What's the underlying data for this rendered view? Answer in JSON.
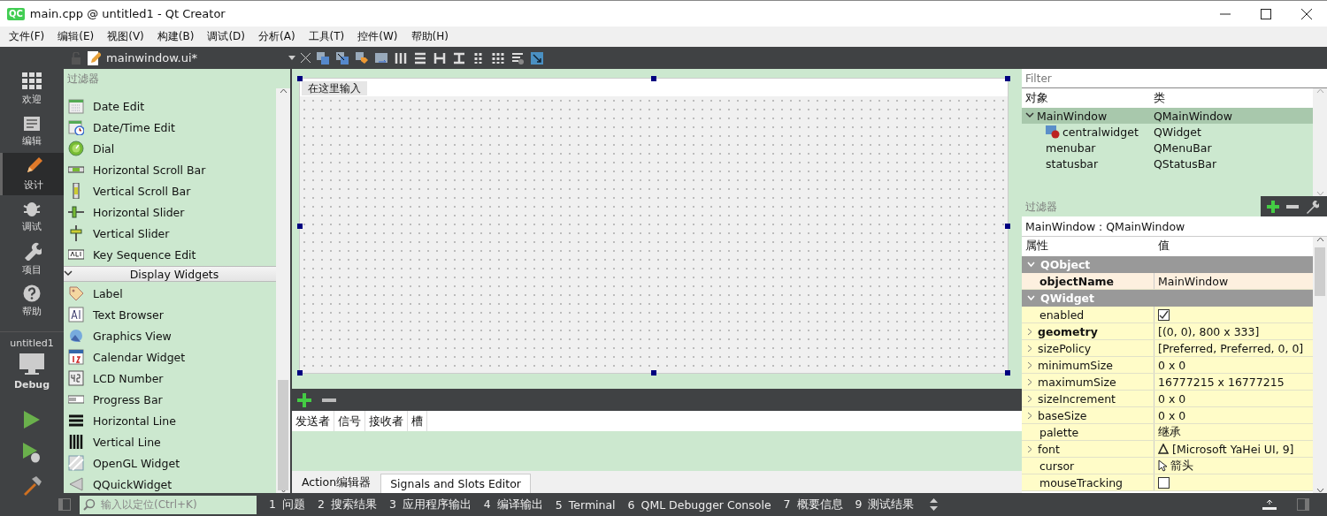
{
  "window": {
    "logo": "QC",
    "title": "main.cpp @ untitled1 - Qt Creator"
  },
  "menu": [
    "文件(F)",
    "编辑(E)",
    "视图(V)",
    "构建(B)",
    "调试(D)",
    "分析(A)",
    "工具(T)",
    "控件(W)",
    "帮助(H)"
  ],
  "modes": [
    {
      "kind": "welcome",
      "label": "欢迎",
      "selected": false
    },
    {
      "kind": "edit",
      "label": "编辑",
      "selected": false
    },
    {
      "kind": "design",
      "label": "设计",
      "selected": true
    },
    {
      "kind": "debug",
      "label": "调试",
      "selected": false
    },
    {
      "kind": "projects",
      "label": "项目",
      "selected": false
    },
    {
      "kind": "help",
      "label": "帮助",
      "selected": false
    }
  ],
  "project": {
    "name": "untitled1",
    "config": "Debug"
  },
  "editor": {
    "file": "mainwindow.ui*"
  },
  "widget_box": {
    "filter_placeholder": "过滤器",
    "items": [
      {
        "kind": "item",
        "label": "Date Edit"
      },
      {
        "kind": "item",
        "label": "Date/Time Edit"
      },
      {
        "kind": "item",
        "label": "Dial"
      },
      {
        "kind": "item",
        "label": "Horizontal Scroll Bar"
      },
      {
        "kind": "item",
        "label": "Vertical Scroll Bar"
      },
      {
        "kind": "item",
        "label": "Horizontal Slider"
      },
      {
        "kind": "item",
        "label": "Vertical Slider"
      },
      {
        "kind": "item",
        "label": "Key Sequence Edit"
      },
      {
        "kind": "category",
        "label": "Display Widgets",
        "expanded": true
      },
      {
        "kind": "item",
        "label": "Label"
      },
      {
        "kind": "item",
        "label": "Text Browser"
      },
      {
        "kind": "item",
        "label": "Graphics View"
      },
      {
        "kind": "item",
        "label": "Calendar Widget"
      },
      {
        "kind": "item",
        "label": "LCD Number"
      },
      {
        "kind": "item",
        "label": "Progress Bar"
      },
      {
        "kind": "item",
        "label": "Horizontal Line"
      },
      {
        "kind": "item",
        "label": "Vertical Line"
      },
      {
        "kind": "item",
        "label": "OpenGL Widget"
      },
      {
        "kind": "item",
        "label": "QQuickWidget"
      }
    ]
  },
  "form": {
    "menu_hint": "在这里输入"
  },
  "signals_editor": {
    "columns": [
      "发送者",
      "信号",
      "接收者",
      "槽"
    ],
    "tabs": [
      {
        "label": "Action编辑器",
        "selected": false
      },
      {
        "label": "Signals and Slots Editor",
        "selected": true
      }
    ]
  },
  "object_inspector": {
    "filter_placeholder": "Filter",
    "columns": [
      "对象",
      "类"
    ],
    "tree": [
      {
        "name": "MainWindow",
        "class": "QMainWindow",
        "selected": true,
        "expanded": true,
        "children": [
          {
            "name": "centralwidget",
            "class": "QWidget",
            "selected": false,
            "kind": "icon"
          },
          {
            "name": "menubar",
            "class": "QMenuBar",
            "selected": false,
            "kind": "plain"
          },
          {
            "name": "statusbar",
            "class": "QStatusBar",
            "selected": false,
            "kind": "plain"
          }
        ]
      }
    ]
  },
  "property_editor": {
    "filter_placeholder": "过滤器",
    "object": "MainWindow : QMainWindow",
    "columns": [
      "属性",
      "值"
    ],
    "groups": [
      {
        "name": "QObject",
        "expanded": true,
        "color": "#fdf0df",
        "properties": [
          {
            "name": "objectName",
            "kind": "text",
            "value": "MainWindow",
            "modified": true,
            "expandable": false
          }
        ]
      },
      {
        "name": "QWidget",
        "expanded": true,
        "color": "#fffcc8",
        "properties": [
          {
            "name": "enabled",
            "kind": "checkbox",
            "checked": true,
            "modified": false,
            "expandable": false
          },
          {
            "name": "geometry",
            "kind": "text",
            "value": "[(0, 0), 800 x 333]",
            "modified": true,
            "expandable": true
          },
          {
            "name": "sizePolicy",
            "kind": "text",
            "value": "[Preferred, Preferred, 0, 0]",
            "modified": false,
            "expandable": true
          },
          {
            "name": "minimumSize",
            "kind": "text",
            "value": "0 x 0",
            "modified": false,
            "expandable": true
          },
          {
            "name": "maximumSize",
            "kind": "text",
            "value": "16777215 x 16777215",
            "modified": false,
            "expandable": true
          },
          {
            "name": "sizeIncrement",
            "kind": "text",
            "value": "0 x 0",
            "modified": false,
            "expandable": true
          },
          {
            "name": "baseSize",
            "kind": "text",
            "value": "0 x 0",
            "modified": false,
            "expandable": true
          },
          {
            "name": "palette",
            "kind": "text",
            "value": "继承",
            "modified": false,
            "expandable": false
          },
          {
            "name": "font",
            "kind": "font",
            "value": "[Microsoft YaHei UI, 9]",
            "modified": false,
            "expandable": true
          },
          {
            "name": "cursor",
            "kind": "cursor",
            "value": "箭头",
            "modified": false,
            "expandable": false
          },
          {
            "name": "mouseTracking",
            "kind": "checkbox",
            "checked": false,
            "modified": false,
            "expandable": false
          }
        ]
      }
    ]
  },
  "locator": {
    "placeholder": "输入以定位(Ctrl+K)"
  },
  "output_tabs": [
    {
      "num": "1",
      "label": "问题"
    },
    {
      "num": "2",
      "label": "搜索结果"
    },
    {
      "num": "3",
      "label": "应用程序输出"
    },
    {
      "num": "4",
      "label": "编译输出"
    },
    {
      "num": "5",
      "label": "Terminal"
    },
    {
      "num": "6",
      "label": "QML Debugger Console"
    },
    {
      "num": "7",
      "label": "概要信息"
    },
    {
      "num": "9",
      "label": "测试结果"
    }
  ]
}
